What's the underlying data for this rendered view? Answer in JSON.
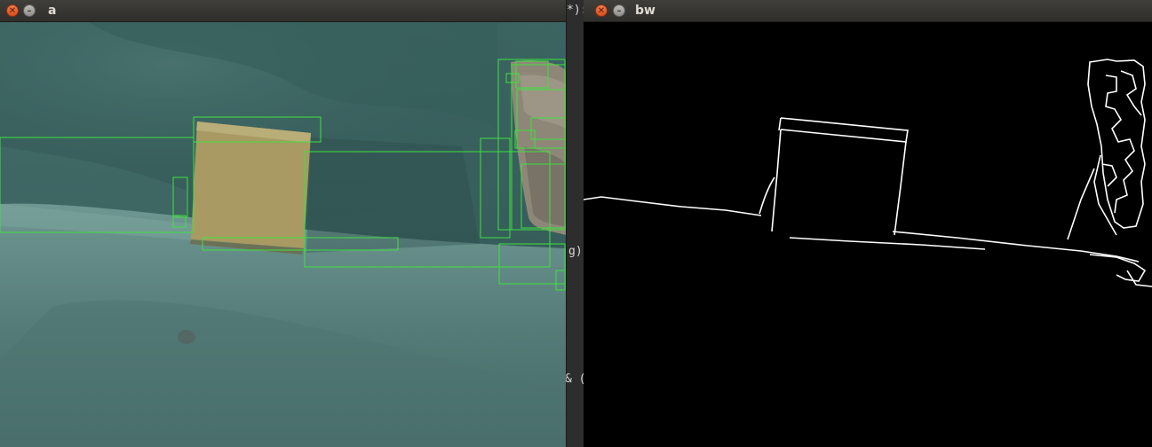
{
  "window_a": {
    "title": "a"
  },
  "window_bw": {
    "title": "bw"
  },
  "terminal": {
    "fragment_top": "*):",
    "fragment_mid": "g)",
    "fragment_low": "& ("
  },
  "controls": {
    "close_glyph": "✕",
    "minimize_glyph": "–"
  },
  "colors": {
    "detection_box": "#3ee23e",
    "edge_line": "#ffffff",
    "bw_background": "#000000",
    "sofa_teal": "#3f6b68",
    "box_tan": "#a89a62"
  }
}
